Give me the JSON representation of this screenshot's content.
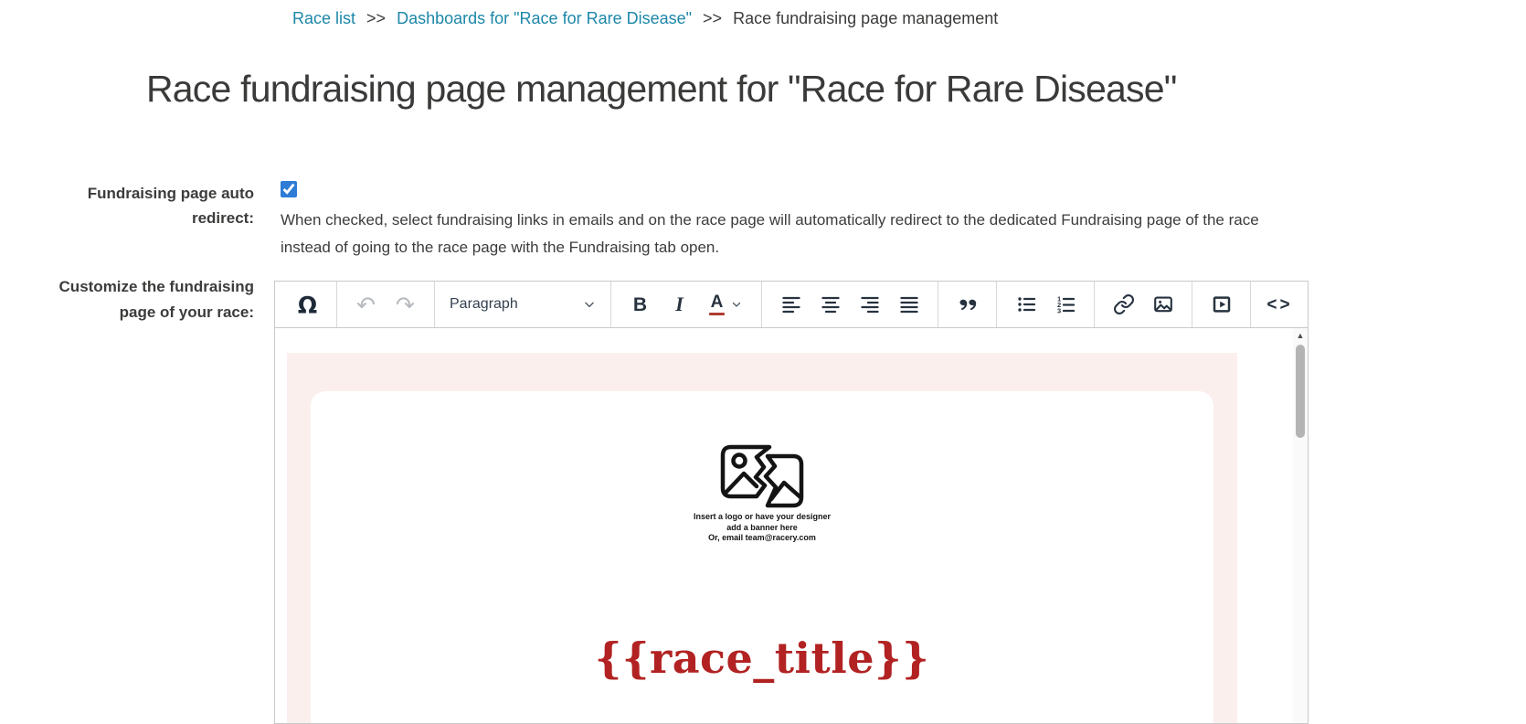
{
  "breadcrumb": {
    "separator": ">>",
    "items": [
      {
        "label": "Race list"
      },
      {
        "label": "Dashboards for \"Race for Rare Disease\""
      },
      {
        "label": "Race fundraising page management"
      }
    ]
  },
  "page_title": "Race fundraising page management for \"Race for Rare Disease\"",
  "form": {
    "auto_redirect": {
      "label": "Fundraising page auto redirect:",
      "checked": true,
      "help": "When checked, select fundraising links in emails and on the race page will automatically redirect to the dedicated Fundraising page of the race instead of going to the race page with the Fundraising tab open."
    },
    "customize": {
      "label": "Customize the fundraising page of your race:"
    }
  },
  "editor": {
    "toolbar": {
      "special_character_glyph": "Ω",
      "undo_glyph": "↶",
      "redo_glyph": "↷",
      "paragraph_label": "Paragraph",
      "bold_label": "B",
      "italic_label": "I",
      "forecolor_label": "A",
      "code_label": "<>"
    },
    "content": {
      "banner_note": {
        "lines": [
          "Insert a logo or have your designer",
          "add a banner here",
          "Or, email team@racery.com"
        ]
      },
      "race_title_token": "{{race_title}}"
    },
    "scrollbar": {
      "up_glyph": "▲"
    }
  },
  "colors": {
    "link": "#1d87a9",
    "checkbox_accent": "#2e7cd6",
    "toolbar_icon": "#27323f",
    "toolbar_icon_disabled": "#b6babf",
    "forecolor_bar": "#b03a2e",
    "page_pink": "#fbefed",
    "race_title_red": "#b22222"
  }
}
